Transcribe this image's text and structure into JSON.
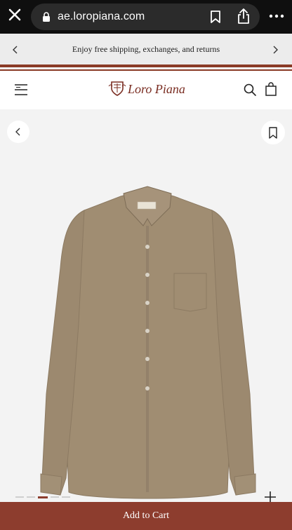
{
  "browser": {
    "url": "ae.loropiana.com"
  },
  "promo": {
    "text": "Enjoy free shipping, exchanges, and returns"
  },
  "header": {
    "brand": "Loro Piana"
  },
  "gallery": {
    "image_count": 5,
    "active_index": 2
  },
  "actions": {
    "add_to_cart": "Add to Cart"
  },
  "colors": {
    "brand": "#8d3d2e",
    "shirt": "#a08d72"
  }
}
